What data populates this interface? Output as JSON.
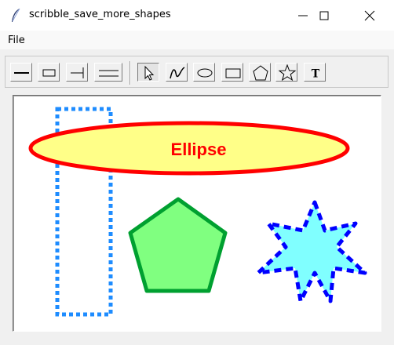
{
  "window": {
    "title": "scribble_save_more_shapes",
    "controls": [
      "minimize-icon",
      "maximize-icon",
      "close-icon"
    ]
  },
  "menubar": {
    "items": [
      "File"
    ]
  },
  "toolbar": {
    "tools": [
      "line-thin-icon",
      "rectangle-small-icon",
      "line-end-icon",
      "line-double-icon",
      "select-arrow-icon",
      "freehand-icon",
      "ellipse-tool-icon",
      "rectangle-tool-icon",
      "polygon-tool-icon",
      "star-tool-icon",
      "text-tool-icon"
    ],
    "active_tool": "select-arrow-icon",
    "text_tool_label": "T"
  },
  "canvas": {
    "shapes": [
      {
        "type": "rectangle",
        "outline": "#1e8cff",
        "style": "dotted"
      },
      {
        "type": "ellipse",
        "fill": "#ffff88",
        "outline": "#ff0000",
        "label": "Ellipse",
        "label_color": "#ff0000"
      },
      {
        "type": "pentagon",
        "fill": "#80ff80",
        "outline": "#00a030"
      },
      {
        "type": "star",
        "fill": "#80ffff",
        "outline": "#0000ff",
        "style": "dashed"
      }
    ]
  }
}
